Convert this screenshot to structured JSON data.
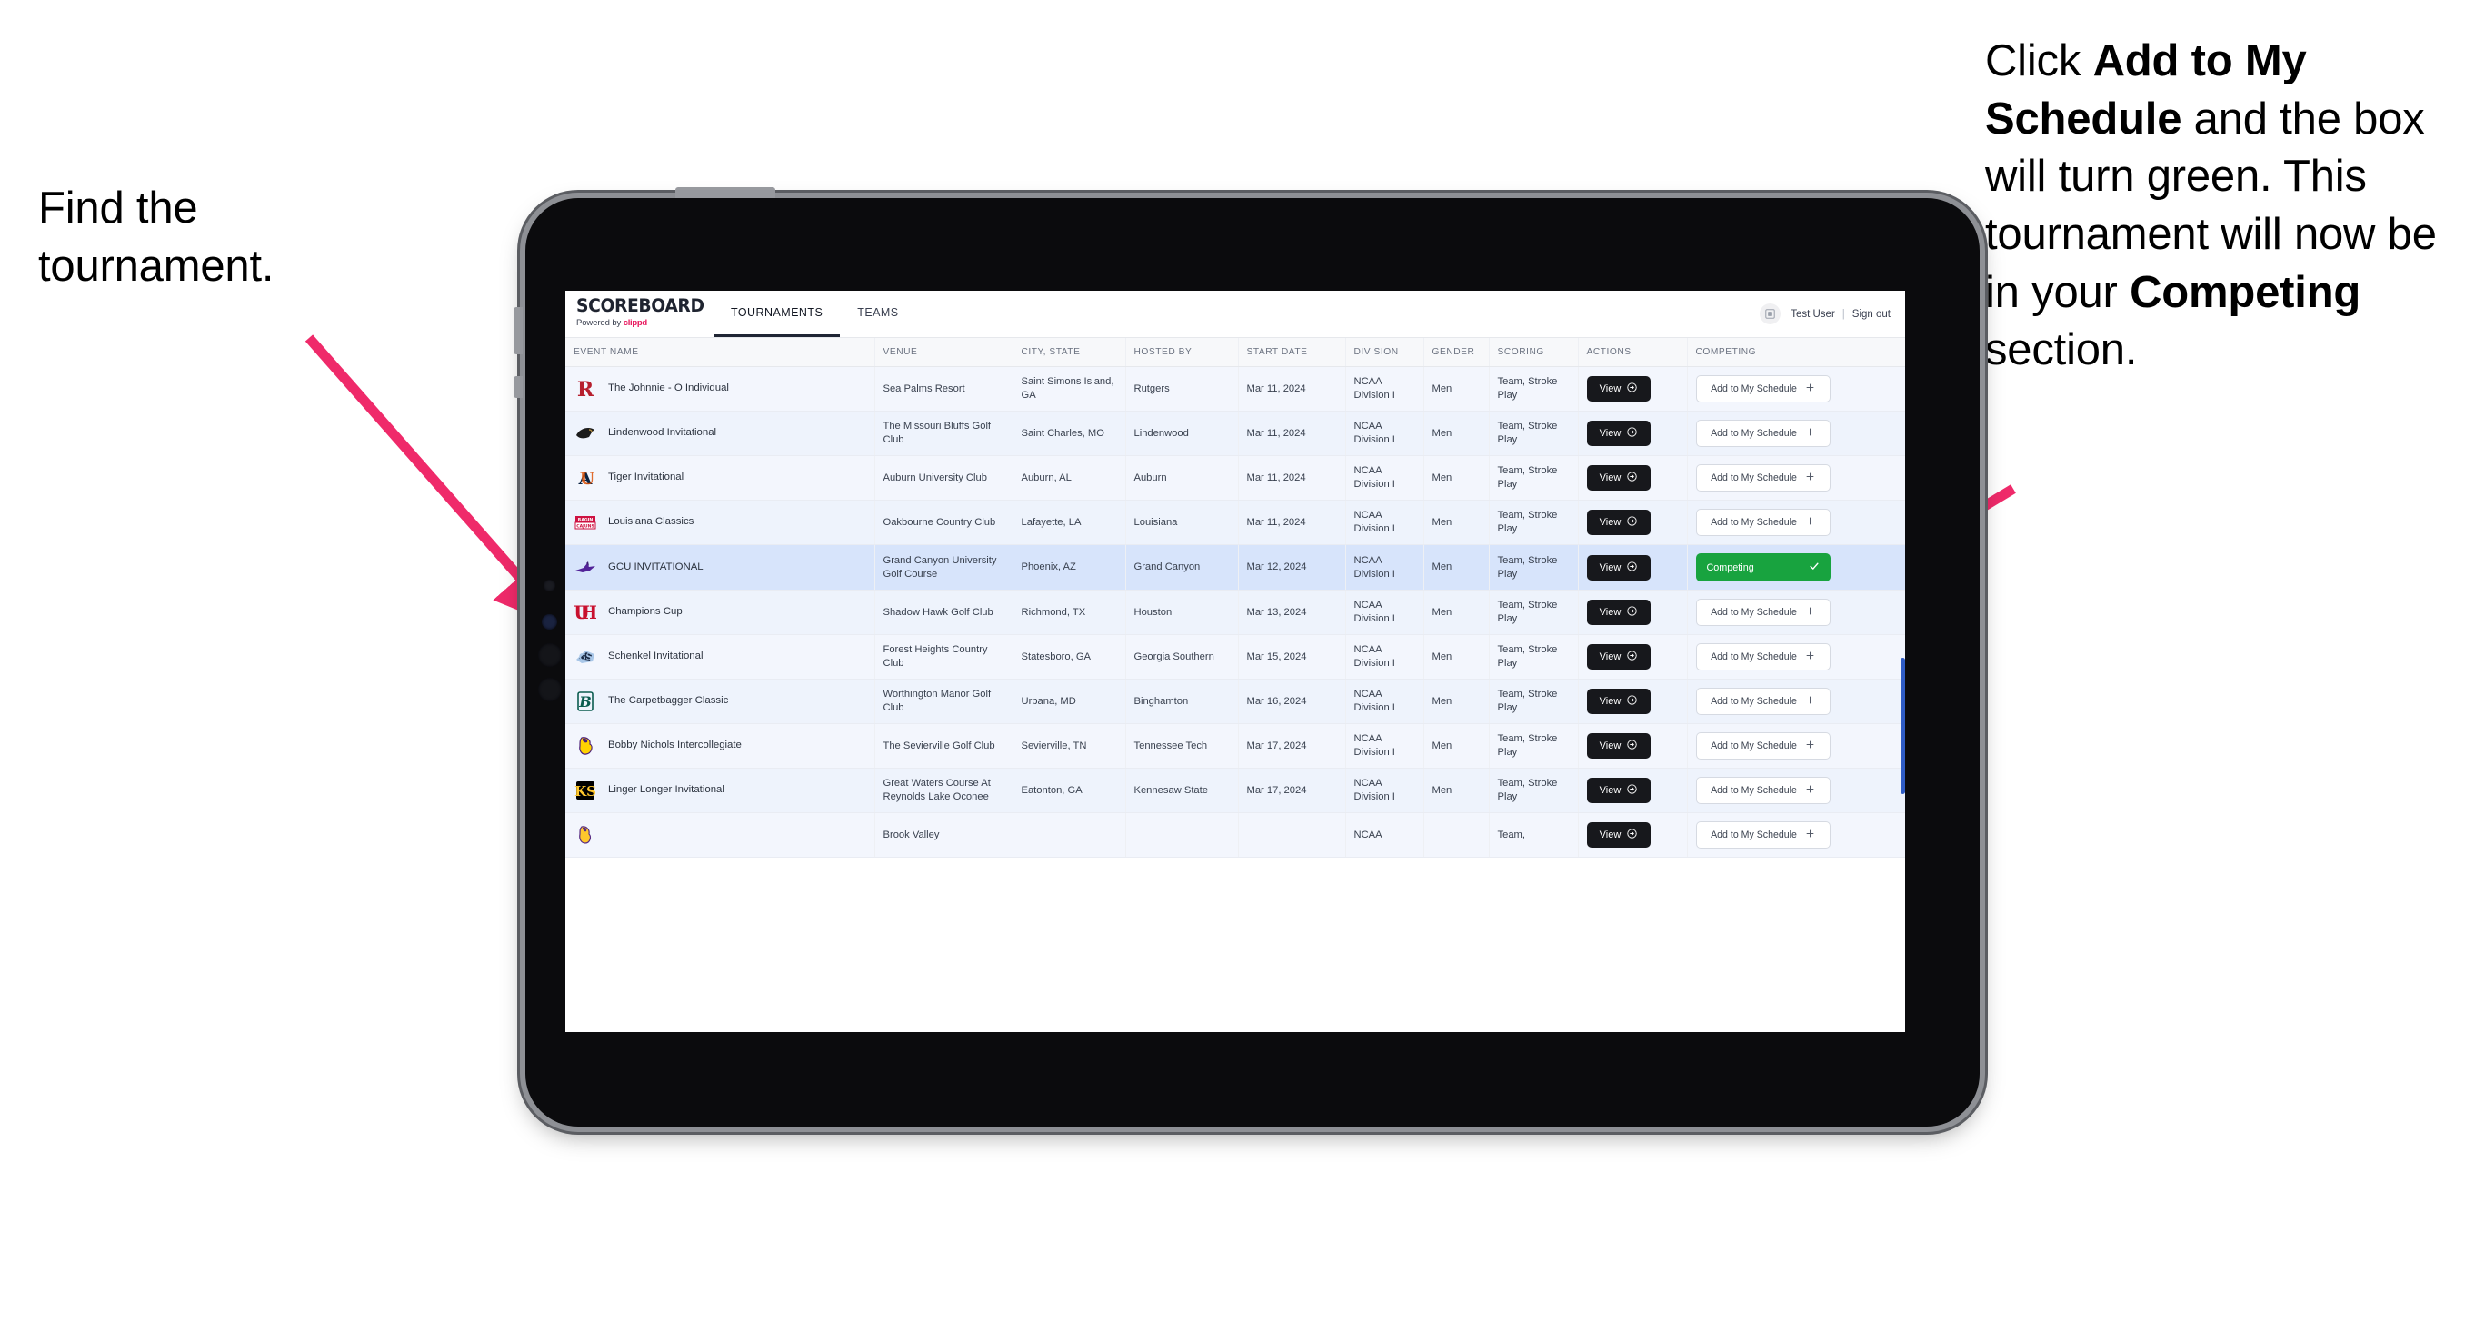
{
  "annotations": {
    "left": {
      "text": "Find the tournament."
    },
    "right": {
      "seg1": "Click ",
      "bold1": "Add to My Schedule",
      "seg2": " and the box will turn green. This tournament will now be in your ",
      "bold2": "Competing",
      "seg3": " section."
    }
  },
  "app": {
    "brand": {
      "name": "SCOREBOARD",
      "powered_prefix": "Powered by ",
      "powered_brand": "clippd"
    },
    "tabs": [
      {
        "label": "TOURNAMENTS",
        "active": true
      },
      {
        "label": "TEAMS",
        "active": false
      }
    ],
    "user": {
      "name": "Test User",
      "separator": "|",
      "sign_out": "Sign out",
      "avatar_icon": "user-avatar-icon"
    },
    "table": {
      "columns": [
        "EVENT NAME",
        "VENUE",
        "CITY, STATE",
        "HOSTED BY",
        "START DATE",
        "DIVISION",
        "GENDER",
        "SCORING",
        "ACTIONS",
        "COMPETING"
      ],
      "action_label": "View",
      "add_label": "Add to My Schedule",
      "competing_label": "Competing",
      "rows": [
        {
          "event": "The Johnnie - O Individual",
          "venue": "Sea Palms Resort",
          "city": "Saint Simons Island, GA",
          "host": "Rutgers",
          "date": "Mar 11, 2024",
          "division": "NCAA Division I",
          "gender": "Men",
          "scoring": "Team, Stroke Play",
          "competing": false,
          "logo": "rutgers-logo"
        },
        {
          "event": "Lindenwood Invitational",
          "venue": "The Missouri Bluffs Golf Club",
          "city": "Saint Charles, MO",
          "host": "Lindenwood",
          "date": "Mar 11, 2024",
          "division": "NCAA Division I",
          "gender": "Men",
          "scoring": "Team, Stroke Play",
          "competing": false,
          "logo": "lindenwood-logo"
        },
        {
          "event": "Tiger Invitational",
          "venue": "Auburn University Club",
          "city": "Auburn, AL",
          "host": "Auburn",
          "date": "Mar 11, 2024",
          "division": "NCAA Division I",
          "gender": "Men",
          "scoring": "Team, Stroke Play",
          "competing": false,
          "logo": "auburn-logo"
        },
        {
          "event": "Louisiana Classics",
          "venue": "Oakbourne Country Club",
          "city": "Lafayette, LA",
          "host": "Louisiana",
          "date": "Mar 11, 2024",
          "division": "NCAA Division I",
          "gender": "Men",
          "scoring": "Team, Stroke Play",
          "competing": false,
          "logo": "louisiana-logo"
        },
        {
          "event": "GCU INVITATIONAL",
          "venue": "Grand Canyon University Golf Course",
          "city": "Phoenix, AZ",
          "host": "Grand Canyon",
          "date": "Mar 12, 2024",
          "division": "NCAA Division I",
          "gender": "Men",
          "scoring": "Team, Stroke Play",
          "competing": true,
          "logo": "grand-canyon-logo"
        },
        {
          "event": "Champions Cup",
          "venue": "Shadow Hawk Golf Club",
          "city": "Richmond, TX",
          "host": "Houston",
          "date": "Mar 13, 2024",
          "division": "NCAA Division I",
          "gender": "Men",
          "scoring": "Team, Stroke Play",
          "competing": false,
          "logo": "houston-logo"
        },
        {
          "event": "Schenkel Invitational",
          "venue": "Forest Heights Country Club",
          "city": "Statesboro, GA",
          "host": "Georgia Southern",
          "date": "Mar 15, 2024",
          "division": "NCAA Division I",
          "gender": "Men",
          "scoring": "Team, Stroke Play",
          "competing": false,
          "logo": "georgia-southern-logo"
        },
        {
          "event": "The Carpetbagger Classic",
          "venue": "Worthington Manor Golf Club",
          "city": "Urbana, MD",
          "host": "Binghamton",
          "date": "Mar 16, 2024",
          "division": "NCAA Division I",
          "gender": "Men",
          "scoring": "Team, Stroke Play",
          "competing": false,
          "logo": "binghamton-logo"
        },
        {
          "event": "Bobby Nichols Intercollegiate",
          "venue": "The Sevierville Golf Club",
          "city": "Sevierville, TN",
          "host": "Tennessee Tech",
          "date": "Mar 17, 2024",
          "division": "NCAA Division I",
          "gender": "Men",
          "scoring": "Team, Stroke Play",
          "competing": false,
          "logo": "tennessee-tech-logo"
        },
        {
          "event": "Linger Longer Invitational",
          "venue": "Great Waters Course At Reynolds Lake Oconee",
          "city": "Eatonton, GA",
          "host": "Kennesaw State",
          "date": "Mar 17, 2024",
          "division": "NCAA Division I",
          "gender": "Men",
          "scoring": "Team, Stroke Play",
          "competing": false,
          "logo": "kennesaw-state-logo"
        },
        {
          "event": "",
          "venue": "Brook Valley",
          "city": "",
          "host": "",
          "date": "",
          "division": "NCAA",
          "gender": "",
          "scoring": "Team,",
          "competing": false,
          "logo": "ecu-logo"
        }
      ]
    }
  },
  "colors": {
    "accent_pink": "#ef2a6a",
    "green": "#18a33f",
    "dark": "#17181c",
    "row_selected": "#d7e4fb",
    "brand_pink": "#e8175d"
  }
}
